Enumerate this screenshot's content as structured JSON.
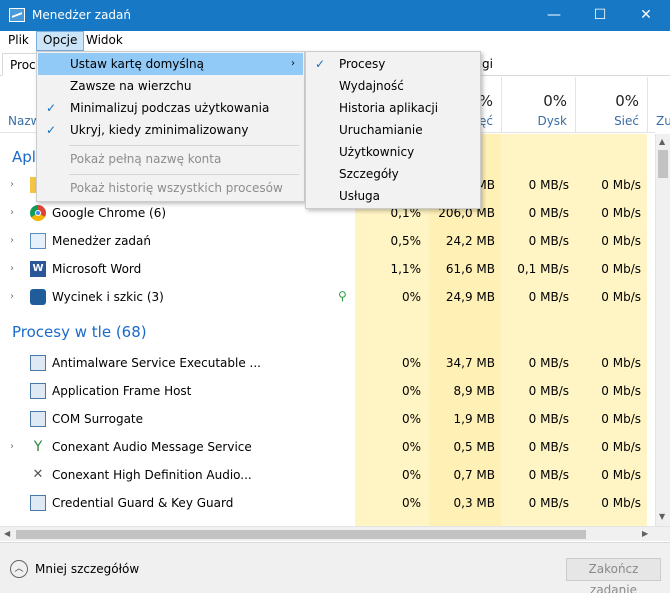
{
  "window": {
    "title": "Menedżer zadań",
    "minimize": "—",
    "maximize": "☐",
    "close": "✕"
  },
  "menubar": {
    "items": [
      "Plik",
      "Opcje",
      "Widok"
    ]
  },
  "tabs": {
    "first_partial": "Proc",
    "last_partial": "gi"
  },
  "header": {
    "name_partial": "Nazw",
    "columns": [
      {
        "pct": "",
        "label": ""
      },
      {
        "pct": "%",
        "label": "ięć"
      },
      {
        "pct": "0%",
        "label": "Dysk"
      },
      {
        "pct": "0%",
        "label": "Sieć"
      },
      {
        "pct": "",
        "label": "Zu"
      }
    ]
  },
  "groups": {
    "apps_partial": "Apl",
    "background": "Procesy w tle (68)"
  },
  "apps": [
    {
      "name": "",
      "cpu": "",
      "mem": "MB",
      "disk": "0 MB/s",
      "net": "0 Mb/s"
    },
    {
      "name": "Google Chrome (6)",
      "cpu": "0,1%",
      "mem": "206,0 MB",
      "disk": "0 MB/s",
      "net": "0 Mb/s"
    },
    {
      "name": "Menedżer zadań",
      "cpu": "0,5%",
      "mem": "24,2 MB",
      "disk": "0 MB/s",
      "net": "0 Mb/s"
    },
    {
      "name": "Microsoft Word",
      "cpu": "1,1%",
      "mem": "61,6 MB",
      "disk": "0,1 MB/s",
      "net": "0 Mb/s"
    },
    {
      "name": "Wycinek i szkic (3)",
      "cpu": "0%",
      "mem": "24,9 MB",
      "disk": "0 MB/s",
      "net": "0 Mb/s"
    }
  ],
  "background": [
    {
      "name": "Antimalware Service Executable ...",
      "cpu": "0%",
      "mem": "34,7 MB",
      "disk": "0 MB/s",
      "net": "0 Mb/s"
    },
    {
      "name": "Application Frame Host",
      "cpu": "0%",
      "mem": "8,9 MB",
      "disk": "0 MB/s",
      "net": "0 Mb/s"
    },
    {
      "name": "COM Surrogate",
      "cpu": "0%",
      "mem": "1,9 MB",
      "disk": "0 MB/s",
      "net": "0 Mb/s"
    },
    {
      "name": "Conexant Audio Message Service",
      "cpu": "0%",
      "mem": "0,5 MB",
      "disk": "0 MB/s",
      "net": "0 Mb/s"
    },
    {
      "name": "Conexant High Definition Audio...",
      "cpu": "0%",
      "mem": "0,7 MB",
      "disk": "0 MB/s",
      "net": "0 Mb/s"
    },
    {
      "name": "Credential Guard & Key Guard",
      "cpu": "0%",
      "mem": "0,3 MB",
      "disk": "0 MB/s",
      "net": "0 Mb/s"
    }
  ],
  "options_menu": {
    "items": [
      {
        "label": "Ustaw kartę domyślną",
        "checked": false,
        "disabled": false,
        "submenu": true
      },
      {
        "label": "Zawsze na wierzchu",
        "checked": false,
        "disabled": false
      },
      {
        "label": "Minimalizuj podczas użytkowania",
        "checked": true,
        "disabled": false
      },
      {
        "label": "Ukryj, kiedy zminimalizowany",
        "checked": true,
        "disabled": false
      },
      {
        "label": "Pokaż pełną nazwę konta",
        "checked": false,
        "disabled": true
      },
      {
        "label": "Pokaż historię wszystkich procesów",
        "checked": false,
        "disabled": true
      }
    ]
  },
  "default_tab_menu": {
    "items": [
      "Procesy",
      "Wydajność",
      "Historia aplikacji",
      "Uruchamianie",
      "Użytkownicy",
      "Szczegóły",
      "Usługa"
    ],
    "checked_index": 0
  },
  "footer": {
    "less_details": "Mniej szczegółów",
    "end_task": "Zakończ zadanie"
  },
  "glyphs": {
    "check": "✓",
    "submenu_arrow": "›",
    "expand": "›",
    "eco_leaf": "⚲"
  },
  "colors": {
    "titlebar": "#1778c6",
    "cpu_col": "#fff4c4",
    "mem_col": "#fff0b6",
    "highlight": "#91c9f7",
    "group_text": "#1b6ac9"
  }
}
